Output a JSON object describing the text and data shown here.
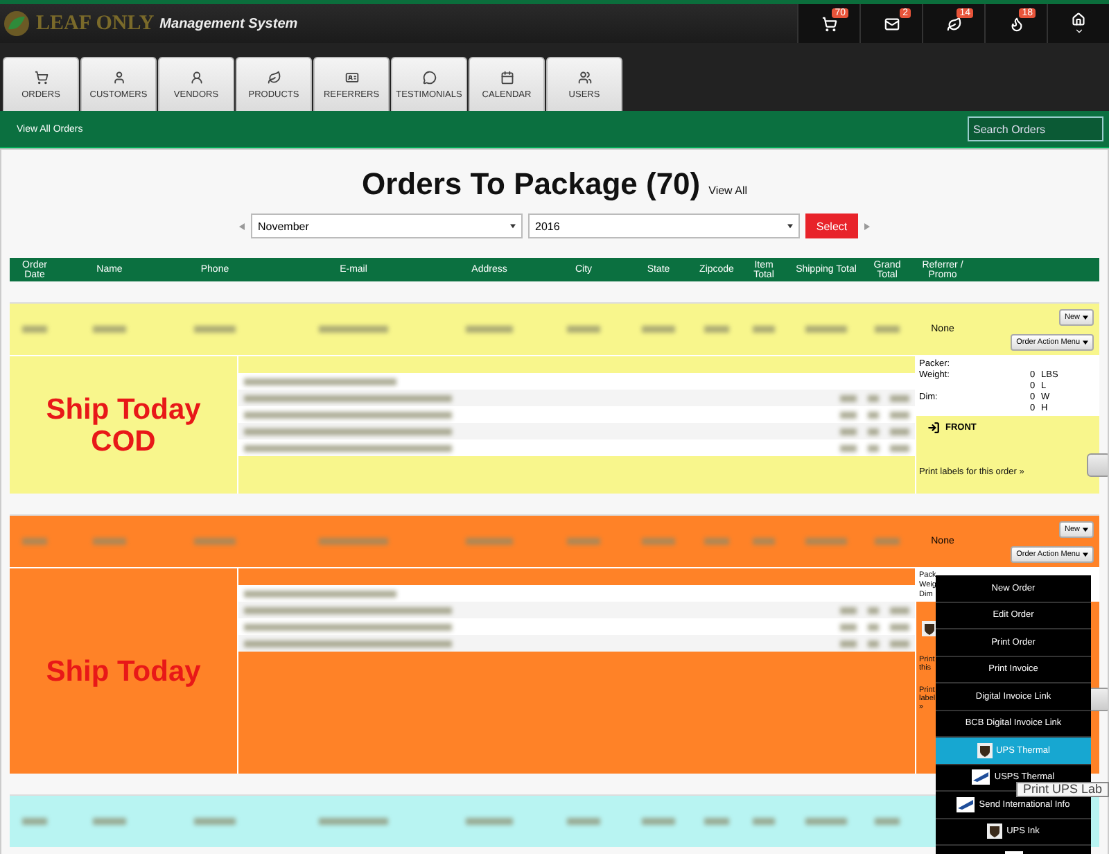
{
  "header": {
    "logo": "LEAF ONLY",
    "subtitle": "Management System",
    "notifications": [
      {
        "kind": "cart",
        "count": "70"
      },
      {
        "kind": "mail",
        "count": "2"
      },
      {
        "kind": "leaf",
        "count": "14"
      },
      {
        "kind": "flame",
        "count": "18"
      }
    ]
  },
  "tabs": [
    {
      "kind": "cart",
      "label": "ORDERS",
      "selected": false
    },
    {
      "kind": "user",
      "label": "CUSTOMERS",
      "selected": false
    },
    {
      "kind": "user-outline",
      "label": "VENDORS",
      "selected": false
    },
    {
      "kind": "leaf",
      "label": "PRODUCTS",
      "selected": false
    },
    {
      "kind": "badge",
      "label": "REFERRERS",
      "selected": false
    },
    {
      "kind": "chat",
      "label": "TESTIMONIALS",
      "selected": false
    },
    {
      "kind": "calendar",
      "label": "CALENDAR",
      "selected": false
    },
    {
      "kind": "users",
      "label": "USERS",
      "selected": false
    }
  ],
  "subbar": {
    "link": "View All Orders",
    "search": {
      "placeholder": "Search Orders"
    }
  },
  "page": {
    "title": "Orders To Package (70)",
    "view_all": "View All",
    "month": "November",
    "year": "2016",
    "select_button": "Select"
  },
  "table": {
    "columns": [
      "Order Date",
      "Name",
      "Phone",
      "E-mail",
      "Address",
      "City",
      "State",
      "Zipcode",
      "Item Total",
      "Shipping Total",
      "Grand Total",
      "Referrer / Promo"
    ],
    "rows": [
      {
        "color": "#f8f68c",
        "referrer": "None",
        "new_button": "New",
        "action_button": "Order Action Menu",
        "menu_open": false,
        "status_label": "Ship Today COD",
        "item_lines": [
          {
            "kind": "note"
          },
          {
            "kind": "item"
          },
          {
            "kind": "item"
          },
          {
            "kind": "item"
          },
          {
            "kind": "item"
          }
        ],
        "panel": {
          "packer": "Packer:",
          "measures": [
            {
              "label": "Weight:",
              "value": "0",
              "unit": "LBS"
            },
            {
              "value": "0",
              "unit": "L"
            },
            {
              "label": "Dim:",
              "value": "0",
              "unit": "W"
            },
            {
              "value": "0",
              "unit": "H"
            }
          ],
          "front": "FRONT",
          "print": "Print labels for this order »",
          "checked": false
        }
      },
      {
        "color": "#ff8227",
        "referrer": "None",
        "new_button": "New",
        "action_button": "Order Action Menu",
        "menu_open": true,
        "status_label": "Ship Today",
        "item_lines": [
          {
            "kind": "note"
          },
          {
            "kind": "item"
          },
          {
            "kind": "item"
          },
          {
            "kind": "item"
          }
        ],
        "panel": {
          "packer": "Pack",
          "measures": [
            {
              "label": "Weig"
            },
            {
              "label": "Dim"
            }
          ],
          "ups": true,
          "print": "Print this",
          "print2": "Print label »",
          "checked": false
        }
      },
      {
        "color": "#b8f4f2"
      }
    ]
  },
  "action_menu": {
    "items": [
      {
        "kind": "plain",
        "label": "New Order",
        "selected": false
      },
      {
        "kind": "plain",
        "label": "Edit Order",
        "selected": false
      },
      {
        "kind": "plain",
        "label": "Print Order",
        "selected": false
      },
      {
        "kind": "plain",
        "label": "Print Invoice",
        "selected": false
      },
      {
        "kind": "plain",
        "label": "Digital Invoice Link",
        "selected": false
      },
      {
        "kind": "plain",
        "label": "BCB Digital Invoice Link",
        "selected": false
      },
      {
        "kind": "ups",
        "label": "UPS Thermal",
        "selected": true
      },
      {
        "kind": "usps",
        "label": "USPS Thermal",
        "selected": false
      },
      {
        "kind": "usps",
        "label": "Send International Info",
        "selected": false
      },
      {
        "kind": "ups",
        "label": "UPS Ink",
        "selected": false
      },
      {
        "kind": "usps",
        "selected": false
      }
    ],
    "tooltip": "Print UPS Lab"
  }
}
